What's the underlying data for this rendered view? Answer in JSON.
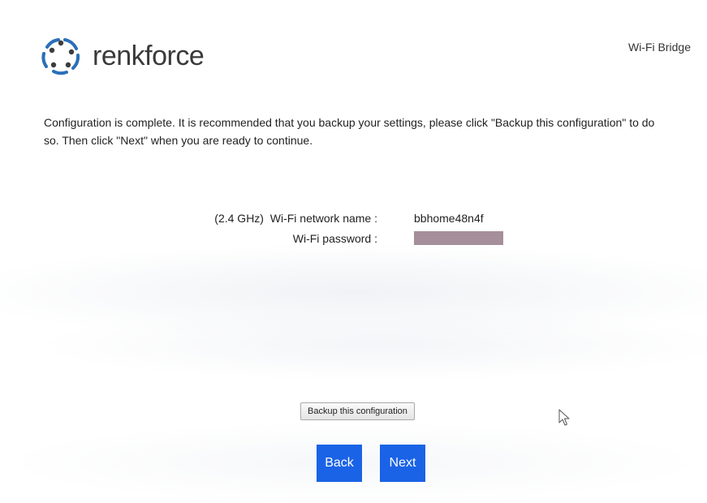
{
  "header": {
    "brand": "renkforce",
    "product": "Wi-Fi Bridge",
    "logo_icon": "renkforce-logo-icon"
  },
  "message": {
    "text": "Configuration is complete. It is recommended that you backup your settings, please click \"Backup this configuration\" to do so. Then click \"Next\" when you are ready to continue."
  },
  "wifi": {
    "network_label": "(2.4 GHz)  Wi-Fi network name :",
    "network_value": "bbhome48n4f",
    "password_label": "Wi-Fi password :",
    "password_mask_color": "#a58f9a"
  },
  "actions": {
    "backup_label": "Backup this configuration",
    "back_label": "Back",
    "next_label": "Next",
    "nav_color": "#1a63e6"
  },
  "cursor": {
    "icon": "mouse-pointer-icon"
  }
}
